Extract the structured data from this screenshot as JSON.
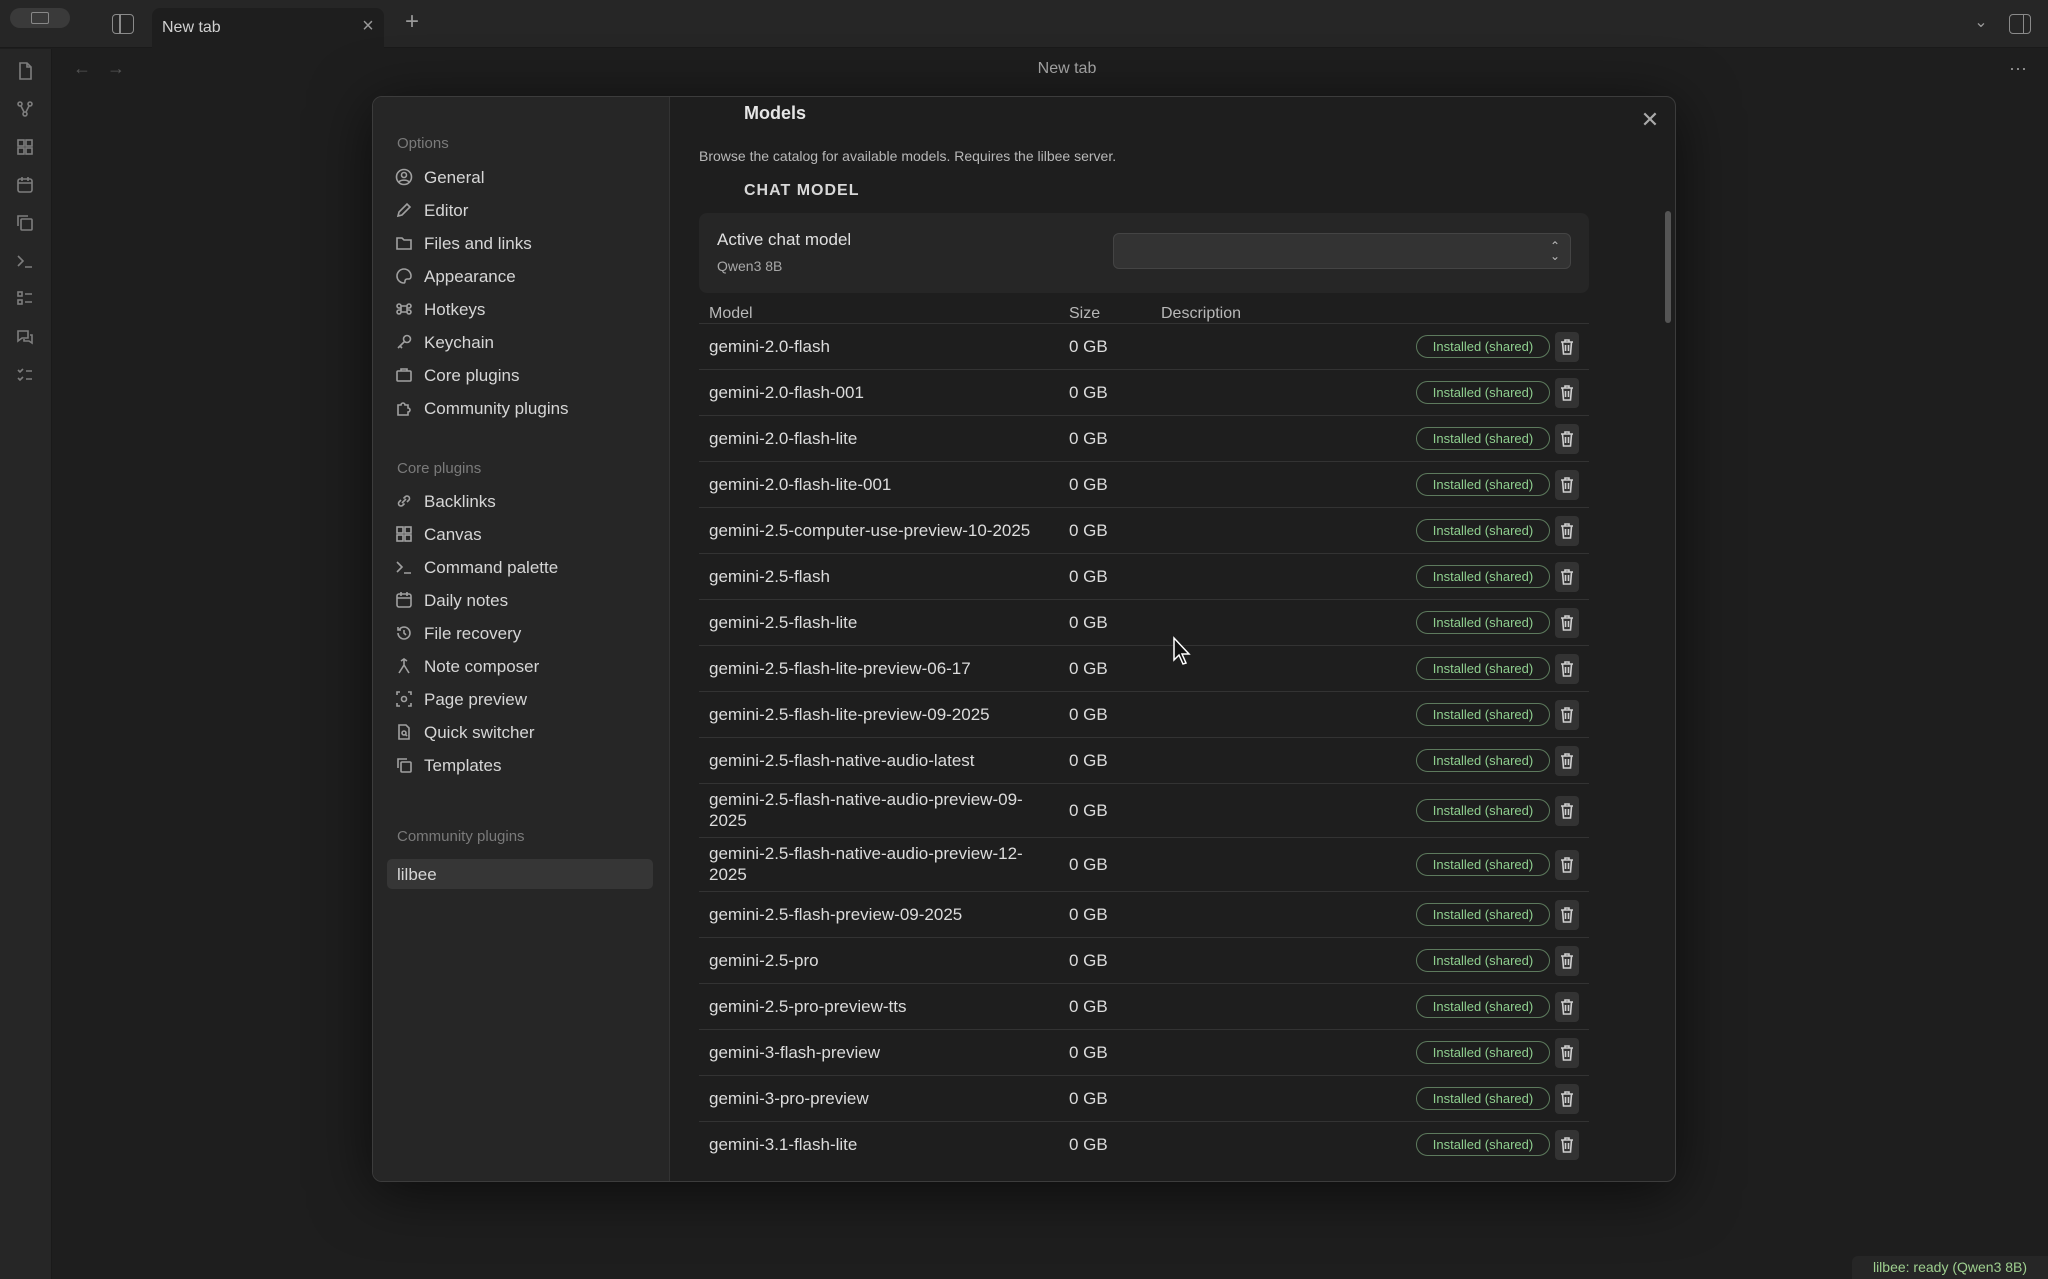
{
  "titlebar": {
    "tab_label": "New tab",
    "view_title": "New tab"
  },
  "settings": {
    "sections": [
      {
        "heading": "Options",
        "items": [
          "General",
          "Editor",
          "Files and links",
          "Appearance",
          "Hotkeys",
          "Keychain",
          "Core plugins",
          "Community plugins"
        ]
      },
      {
        "heading": "Core plugins",
        "items": [
          "Backlinks",
          "Canvas",
          "Command palette",
          "Daily notes",
          "File recovery",
          "Note composer",
          "Page preview",
          "Quick switcher",
          "Templates"
        ]
      },
      {
        "heading": "Community plugins",
        "items": [
          "lilbee"
        ]
      }
    ],
    "active_item": "lilbee"
  },
  "models": {
    "title": "Models",
    "description": "Browse the catalog for available models. Requires the lilbee server.",
    "section_heading": "CHAT MODEL",
    "active_label": "Active chat model",
    "active_value": "Qwen3 8B",
    "columns": [
      "Model",
      "Size",
      "Description"
    ],
    "rows": [
      {
        "name": "gemini-2.0-flash",
        "size": "0 GB",
        "status": "Installed (shared)"
      },
      {
        "name": "gemini-2.0-flash-001",
        "size": "0 GB",
        "status": "Installed (shared)"
      },
      {
        "name": "gemini-2.0-flash-lite",
        "size": "0 GB",
        "status": "Installed (shared)"
      },
      {
        "name": "gemini-2.0-flash-lite-001",
        "size": "0 GB",
        "status": "Installed (shared)"
      },
      {
        "name": "gemini-2.5-computer-use-preview-10-2025",
        "size": "0 GB",
        "status": "Installed (shared)"
      },
      {
        "name": "gemini-2.5-flash",
        "size": "0 GB",
        "status": "Installed (shared)"
      },
      {
        "name": "gemini-2.5-flash-lite",
        "size": "0 GB",
        "status": "Installed (shared)"
      },
      {
        "name": "gemini-2.5-flash-lite-preview-06-17",
        "size": "0 GB",
        "status": "Installed (shared)"
      },
      {
        "name": "gemini-2.5-flash-lite-preview-09-2025",
        "size": "0 GB",
        "status": "Installed (shared)"
      },
      {
        "name": "gemini-2.5-flash-native-audio-latest",
        "size": "0 GB",
        "status": "Installed (shared)"
      },
      {
        "name": "gemini-2.5-flash-native-audio-preview-09-2025",
        "size": "0 GB",
        "status": "Installed (shared)"
      },
      {
        "name": "gemini-2.5-flash-native-audio-preview-12-2025",
        "size": "0 GB",
        "status": "Installed (shared)"
      },
      {
        "name": "gemini-2.5-flash-preview-09-2025",
        "size": "0 GB",
        "status": "Installed (shared)"
      },
      {
        "name": "gemini-2.5-pro",
        "size": "0 GB",
        "status": "Installed (shared)"
      },
      {
        "name": "gemini-2.5-pro-preview-tts",
        "size": "0 GB",
        "status": "Installed (shared)"
      },
      {
        "name": "gemini-3-flash-preview",
        "size": "0 GB",
        "status": "Installed (shared)"
      },
      {
        "name": "gemini-3-pro-preview",
        "size": "0 GB",
        "status": "Installed (shared)"
      },
      {
        "name": "gemini-3.1-flash-lite",
        "size": "0 GB",
        "status": "Installed (shared)"
      }
    ]
  },
  "status_bar": {
    "text": "lilbee: ready (Qwen3 8B)"
  },
  "icons": {
    "ribbon": [
      "file-icon",
      "graph-icon",
      "canvas-icon",
      "calendar-icon",
      "copy-icon",
      "terminal-icon",
      "list-icon",
      "chat-icon",
      "checklist-icon"
    ]
  },
  "colors": {
    "accent_installed": "#8fcf8f",
    "background": "#1e1e1e",
    "panel": "#262626"
  }
}
